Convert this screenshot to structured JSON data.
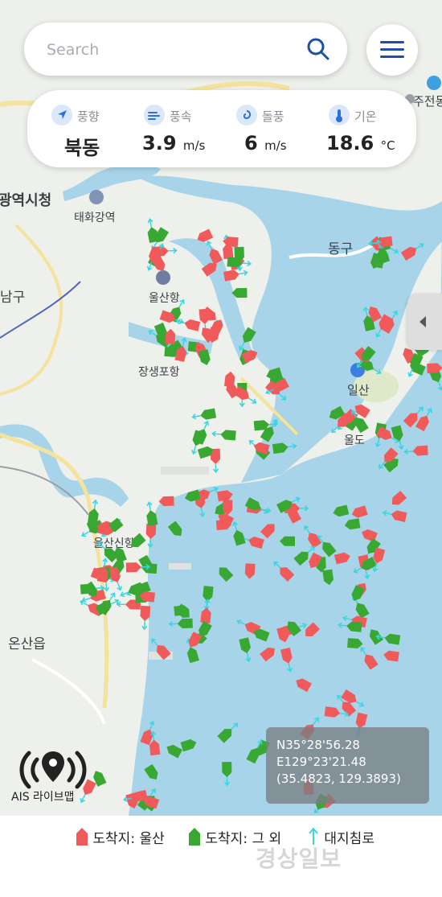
{
  "search": {
    "placeholder": "Search"
  },
  "weather": {
    "wind_direction": {
      "label": "풍향",
      "value": "북동"
    },
    "wind_speed": {
      "label": "풍속",
      "value": "3.9",
      "unit": "m/s"
    },
    "gust": {
      "label": "돌풍",
      "value": "6",
      "unit": "m/s"
    },
    "temperature": {
      "label": "기온",
      "value": "18.6",
      "unit": "°C"
    }
  },
  "map_labels": {
    "city_hall": "광역시청",
    "taehwagang_station": "태화강역",
    "nam_gu": "남구",
    "ulsan_port": "울산항",
    "jangsaengpo_port": "장생포항",
    "dong_gu": "동구",
    "ilsan": "일산",
    "ulsan_new_port": "울산신항",
    "onsan_eup": "온산읍",
    "juncheon": "주전몽",
    "island": "울도"
  },
  "coordinates": {
    "line1": "N35°28'56.28",
    "line2": "E129°23'21.48",
    "line3": "(35.4823, 129.3893)"
  },
  "ais": {
    "label": "AIS 라이브맵"
  },
  "legend": {
    "ulsan": "도착지: 울산",
    "other": "도착지: 그 외",
    "intrusion": "대지침로"
  },
  "watermark": "경상일보",
  "colors": {
    "sea": "#a8d4ea",
    "land": "#eef0ec",
    "ship_ulsan": "#f05a5a",
    "ship_other": "#39a832",
    "heading": "#37d6e0",
    "accent": "#1f4fa8"
  }
}
